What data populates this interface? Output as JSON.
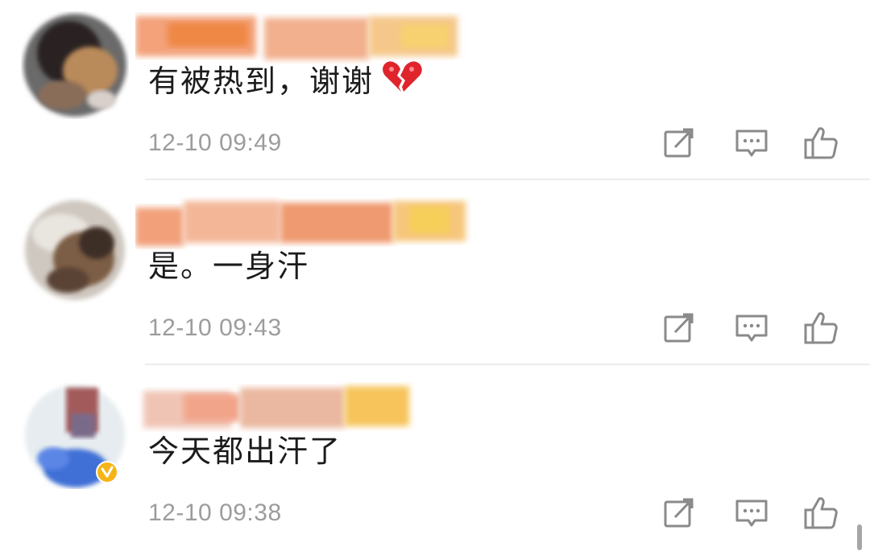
{
  "comments": [
    {
      "text": "有被热到，谢谢",
      "emoji": "broken-heart",
      "time": "12-10 09:49"
    },
    {
      "text": "是。一身汗",
      "time": "12-10 09:43"
    },
    {
      "text": "今天都出汗了",
      "time": "12-10 09:38"
    }
  ],
  "actions": {
    "repost_icon": "repost-icon",
    "reply_icon": "comment-icon",
    "like_icon": "thumbs-up-icon"
  },
  "colors": {
    "text": "#1b1b1b",
    "time": "#9c9c9c",
    "icon": "#8a8a8a",
    "divider": "#ececec",
    "emoji_red": "#e0242c"
  }
}
